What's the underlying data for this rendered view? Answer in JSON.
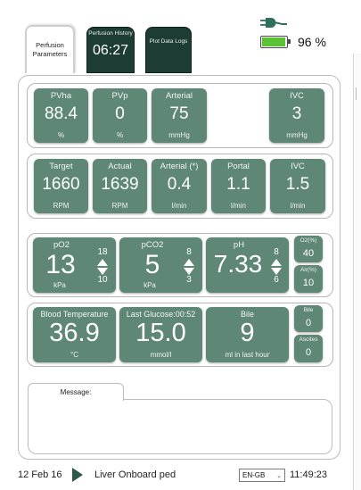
{
  "tabs": {
    "perfusion_parameters": "Perfusion Parameters",
    "perfusion_history": "Perfusion History",
    "history_time": "06:27",
    "plot_data_logs": "Plot Data Logs"
  },
  "status": {
    "battery_percent": "96 %",
    "battery_level": 0.96,
    "icons": [
      "plug-icon",
      "battery-icon"
    ]
  },
  "pressures": [
    {
      "label": "PVha",
      "value": "88.4",
      "unit": "%"
    },
    {
      "label": "PVp",
      "value": "0",
      "unit": "%"
    },
    {
      "label": "Arterial",
      "value": "75",
      "unit": "mmHg"
    },
    {
      "label": "IVC",
      "value": "3",
      "unit": "mmHg"
    }
  ],
  "flows": [
    {
      "label": "Target",
      "value": "1660",
      "unit": "RPM"
    },
    {
      "label": "Actual",
      "value": "1639",
      "unit": "RPM"
    },
    {
      "label": "Arterial (*)",
      "value": "0.4",
      "unit": "l/min"
    },
    {
      "label": "Portal",
      "value": "1.1",
      "unit": "l/min"
    },
    {
      "label": "IVC",
      "value": "1.5",
      "unit": "l/min"
    }
  ],
  "gases": [
    {
      "label": "pO2",
      "value": "13",
      "unit": "kPa",
      "high": "18",
      "low": "10"
    },
    {
      "label": "pCO2",
      "value": "5",
      "unit": "kPa",
      "high": "8",
      "low": "3"
    },
    {
      "label": "pH",
      "value": "7.33",
      "unit": "",
      "high": "8",
      "low": "6"
    }
  ],
  "gas_minis": [
    {
      "label": "O2(%)",
      "value": "40"
    },
    {
      "label": "Air(%)",
      "value": "10"
    }
  ],
  "metrics": [
    {
      "label": "Blood Temperature",
      "value": "36.9",
      "unit": "°C"
    },
    {
      "label": "Last Glucose:00:52",
      "value": "15.0",
      "unit": "mmol/l"
    },
    {
      "label": "Bile",
      "value": "9",
      "unit": "ml in last hour"
    }
  ],
  "metric_minis": [
    {
      "label": "Bile",
      "value": "0"
    },
    {
      "label": "Ascites",
      "value": "0"
    }
  ],
  "message": {
    "tab_label": "Message:",
    "text": ""
  },
  "footer": {
    "date": "12 Feb 16",
    "name": "Liver Onboard ped",
    "language": "EN-GB",
    "time": "11:49:23"
  },
  "colors": {
    "card": "#5f8775",
    "tab_dark": "#1d3c33",
    "battery": "#5bc236"
  }
}
